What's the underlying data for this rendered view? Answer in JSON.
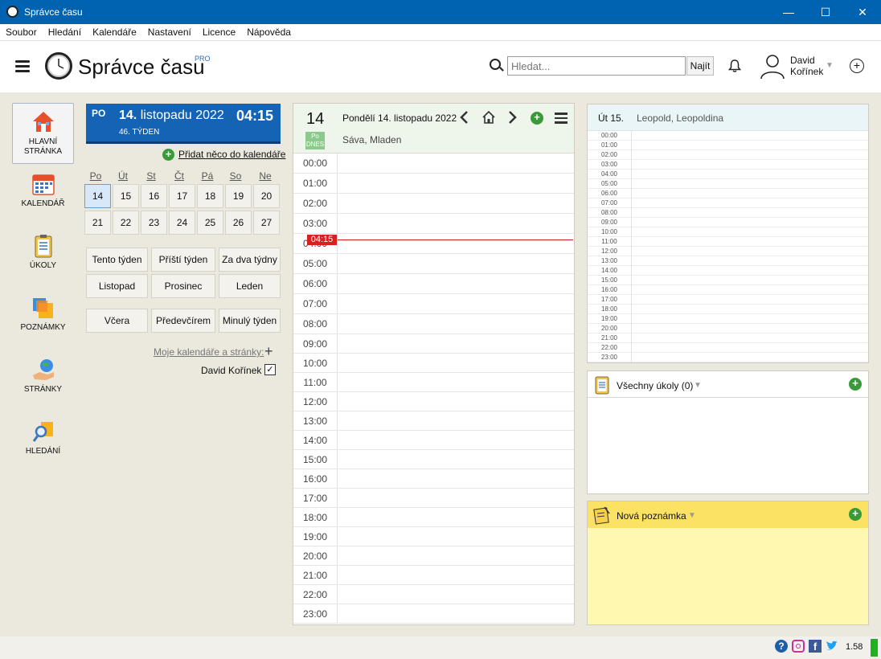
{
  "window": {
    "title": "Správce času",
    "minimize": "—",
    "maximize": "☐",
    "close": "✕"
  },
  "menu": [
    "Soubor",
    "Hledání",
    "Kalendáře",
    "Nastavení",
    "Licence",
    "Nápověda"
  ],
  "header": {
    "app_title": "Správce času",
    "badge": "PRO",
    "search_placeholder": "Hledat...",
    "search_button": "Najít",
    "user_first": "David",
    "user_last": "Kořínek"
  },
  "nav": [
    {
      "label1": "HLAVNÍ",
      "label2": "STRÁNKA",
      "icon": "home-icon"
    },
    {
      "label1": "KALENDÁŘ",
      "label2": "",
      "icon": "calendar-icon"
    },
    {
      "label1": "ÚKOLY",
      "label2": "",
      "icon": "clipboard-icon"
    },
    {
      "label1": "POZNÁMKY",
      "label2": "",
      "icon": "notes-icon"
    },
    {
      "label1": "STRÁNKY",
      "label2": "",
      "icon": "globe-hand-icon"
    },
    {
      "label1": "HLEDÁNÍ",
      "label2": "",
      "icon": "magnifier-icon"
    }
  ],
  "today": {
    "dow": "PO",
    "day": "14.",
    "month_year": "listopadu 2022",
    "time": "04:15",
    "week": "46. TÝDEN"
  },
  "add_link": "Přidat něco do kalendáře",
  "mini_cal": {
    "days": [
      "Po",
      "Út",
      "St",
      "Čt",
      "Pá",
      "So",
      "Ne"
    ],
    "week1": [
      "14",
      "15",
      "16",
      "17",
      "18",
      "19",
      "20"
    ],
    "week2": [
      "21",
      "22",
      "23",
      "24",
      "25",
      "26",
      "27"
    ]
  },
  "quick": [
    [
      "Tento týden",
      "Příští týden",
      "Za dva týdny"
    ],
    [
      "Listopad",
      "Prosinec",
      "Leden"
    ],
    [
      "Včera",
      "Předevčírem",
      "Minulý týden"
    ]
  ],
  "my_calendars": "Moje kalendáře a stránky:",
  "user_calendar": "David Kořínek",
  "dayview": {
    "day_num": "14",
    "badge_dow": "Po",
    "badge_today": "DNES",
    "title": "Pondělí 14. listopadu 2022",
    "names": "Sáva, Mladen",
    "now": "04:15",
    "hours": [
      "00:00",
      "01:00",
      "02:00",
      "03:00",
      "04:00",
      "05:00",
      "06:00",
      "07:00",
      "08:00",
      "09:00",
      "10:00",
      "11:00",
      "12:00",
      "13:00",
      "14:00",
      "15:00",
      "16:00",
      "17:00",
      "18:00",
      "19:00",
      "20:00",
      "21:00",
      "22:00",
      "23:00"
    ]
  },
  "nextday": {
    "day": "Út 15.",
    "names": "Leopold, Leopoldina"
  },
  "tasks": {
    "title": "Všechny úkoly (0)"
  },
  "note": {
    "title": "Nová poznámka"
  },
  "status": {
    "version": "1.58"
  }
}
